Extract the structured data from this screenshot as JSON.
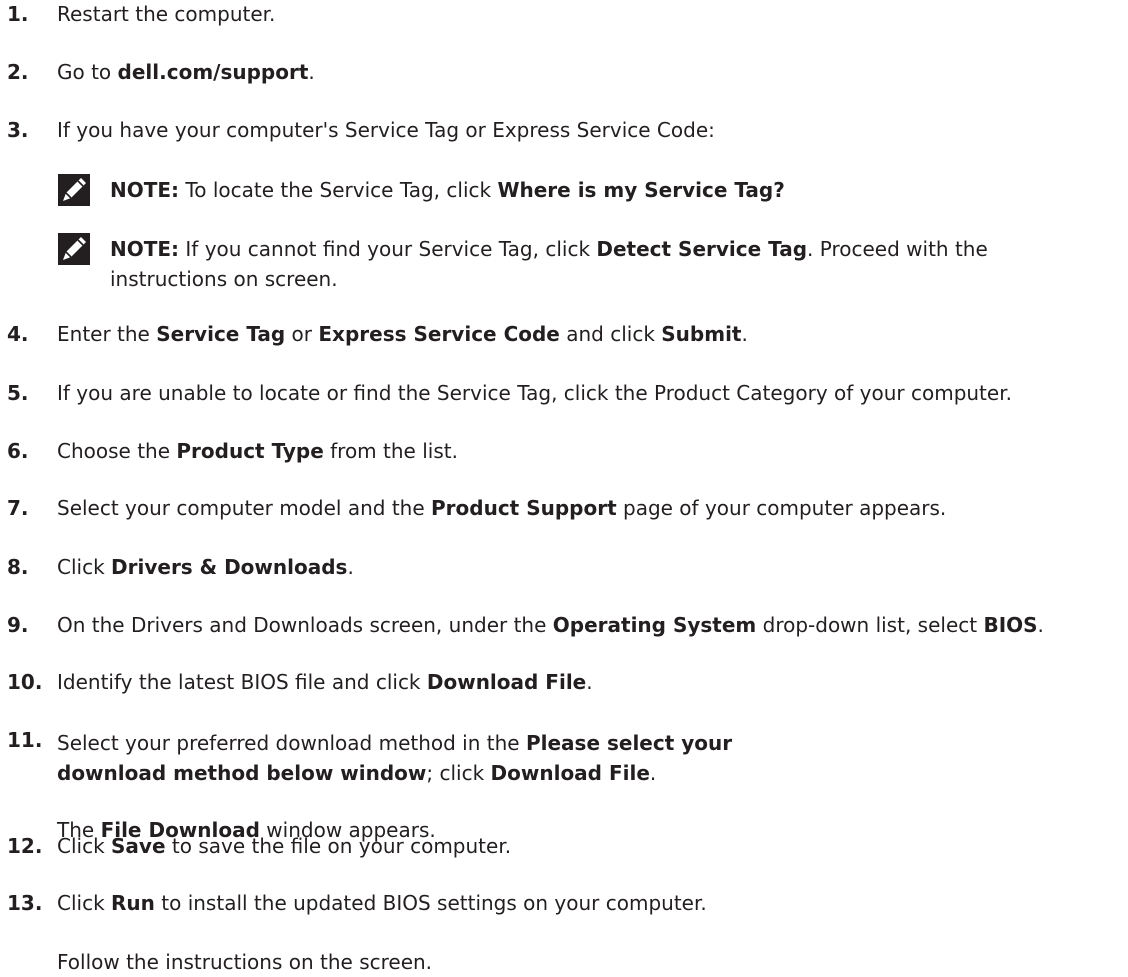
{
  "steps": [
    {
      "num": "1.",
      "parts": [
        {
          "t": "Restart the computer."
        }
      ]
    },
    {
      "num": "2.",
      "parts": [
        {
          "t": "Go to "
        },
        {
          "t": "dell.com/support",
          "b": true
        },
        {
          "t": "."
        }
      ]
    },
    {
      "num": "3.",
      "parts": [
        {
          "t": "If you have your computer's Service Tag or Express Service Code:"
        }
      ]
    },
    {
      "num": "4.",
      "parts": [
        {
          "t": "Enter the "
        },
        {
          "t": "Service Tag",
          "b": true
        },
        {
          "t": " or "
        },
        {
          "t": "Express Service Code",
          "b": true
        },
        {
          "t": " and click "
        },
        {
          "t": "Submit",
          "b": true
        },
        {
          "t": "."
        }
      ]
    },
    {
      "num": "5.",
      "parts": [
        {
          "t": "If you are unable to locate or find the Service Tag, click the Product Category of your computer."
        }
      ]
    },
    {
      "num": "6.",
      "parts": [
        {
          "t": "Choose the "
        },
        {
          "t": "Product Type",
          "b": true
        },
        {
          "t": " from the list."
        }
      ]
    },
    {
      "num": "7.",
      "parts": [
        {
          "t": "Select your computer model and the "
        },
        {
          "t": "Product Support",
          "b": true
        },
        {
          "t": " page of your computer appears."
        }
      ]
    },
    {
      "num": "8.",
      "parts": [
        {
          "t": "Click "
        },
        {
          "t": "Drivers & Downloads",
          "b": true
        },
        {
          "t": "."
        }
      ]
    },
    {
      "num": "9.",
      "parts": [
        {
          "t": "On the Drivers and Downloads screen, under the "
        },
        {
          "t": "Operating System",
          "b": true
        },
        {
          "t": " drop-down list, select "
        },
        {
          "t": "BIOS",
          "b": true
        },
        {
          "t": "."
        }
      ]
    },
    {
      "num": "10.",
      "parts": [
        {
          "t": "Identify the latest BIOS file and click "
        },
        {
          "t": "Download File",
          "b": true
        },
        {
          "t": "."
        }
      ]
    },
    {
      "num": "11.",
      "parts": [
        {
          "t": "Select your preferred download method in the "
        },
        {
          "t": "Please select your download method below window",
          "b": true
        },
        {
          "t": "; click "
        },
        {
          "t": "Download File",
          "b": true
        },
        {
          "t": "."
        }
      ],
      "sub": [
        {
          "t": "The "
        },
        {
          "t": "File Download",
          "b": true
        },
        {
          "t": " window appears."
        }
      ]
    },
    {
      "num": "12.",
      "parts": [
        {
          "t": "Click "
        },
        {
          "t": "Save",
          "b": true
        },
        {
          "t": " to save the file on your computer."
        }
      ]
    },
    {
      "num": "13.",
      "parts": [
        {
          "t": "Click "
        },
        {
          "t": "Run",
          "b": true
        },
        {
          "t": " to install the updated BIOS settings on your computer."
        }
      ],
      "sub": [
        {
          "t": "Follow the instructions on the screen."
        }
      ]
    }
  ],
  "notes": [
    {
      "parts": [
        {
          "t": "NOTE:",
          "b": true
        },
        {
          "t": " To locate the Service Tag, click "
        },
        {
          "t": "Where is my Service Tag?",
          "b": true
        }
      ]
    },
    {
      "parts": [
        {
          "t": "NOTE:",
          "b": true
        },
        {
          "t": " If you cannot find your Service Tag, click "
        },
        {
          "t": "Detect Service Tag",
          "b": true
        },
        {
          "t": ". Proceed with the instructions on screen."
        }
      ]
    }
  ],
  "icons": {
    "note": "pencil-note-icon"
  },
  "colors": {
    "text": "#231f20"
  }
}
